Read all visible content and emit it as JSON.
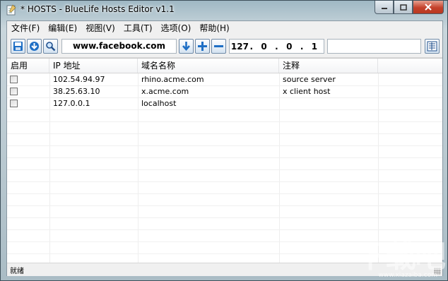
{
  "window": {
    "title": "* HOSTS - BlueLife Hosts Editor v1.1",
    "controls": {
      "minimize": "–",
      "maximize": "□",
      "close": "✕"
    }
  },
  "menu": [
    "文件(F)",
    "编辑(E)",
    "视图(V)",
    "工具(T)",
    "选项(O)",
    "帮助(H)"
  ],
  "toolbar": {
    "domain_value": "www.facebook.com",
    "ip_octets": [
      "127",
      "0",
      "0",
      "1"
    ],
    "ip_separator": ".",
    "comment_value": "",
    "icons": [
      "save-icon",
      "import-icon",
      "search-icon",
      "move-down-icon",
      "add-icon",
      "remove-icon",
      "list-view-icon"
    ]
  },
  "table": {
    "columns": [
      "启用",
      "IP 地址",
      "域名名称",
      "注释"
    ],
    "rows": [
      {
        "enabled": false,
        "ip": "102.54.94.97",
        "host": "rhino.acme.com",
        "comment": "source server"
      },
      {
        "enabled": false,
        "ip": "38.25.63.10",
        "host": "x.acme.com",
        "comment": "x client host"
      },
      {
        "enabled": false,
        "ip": "127.0.0.1",
        "host": "localhost",
        "comment": ""
      }
    ]
  },
  "status": {
    "text": "就绪"
  },
  "watermark": {
    "main": "下载吧",
    "sub": "www.xiazaiba.com"
  },
  "colors": {
    "accent_blue": "#1f6fc5",
    "close_red": "#c4412b"
  }
}
